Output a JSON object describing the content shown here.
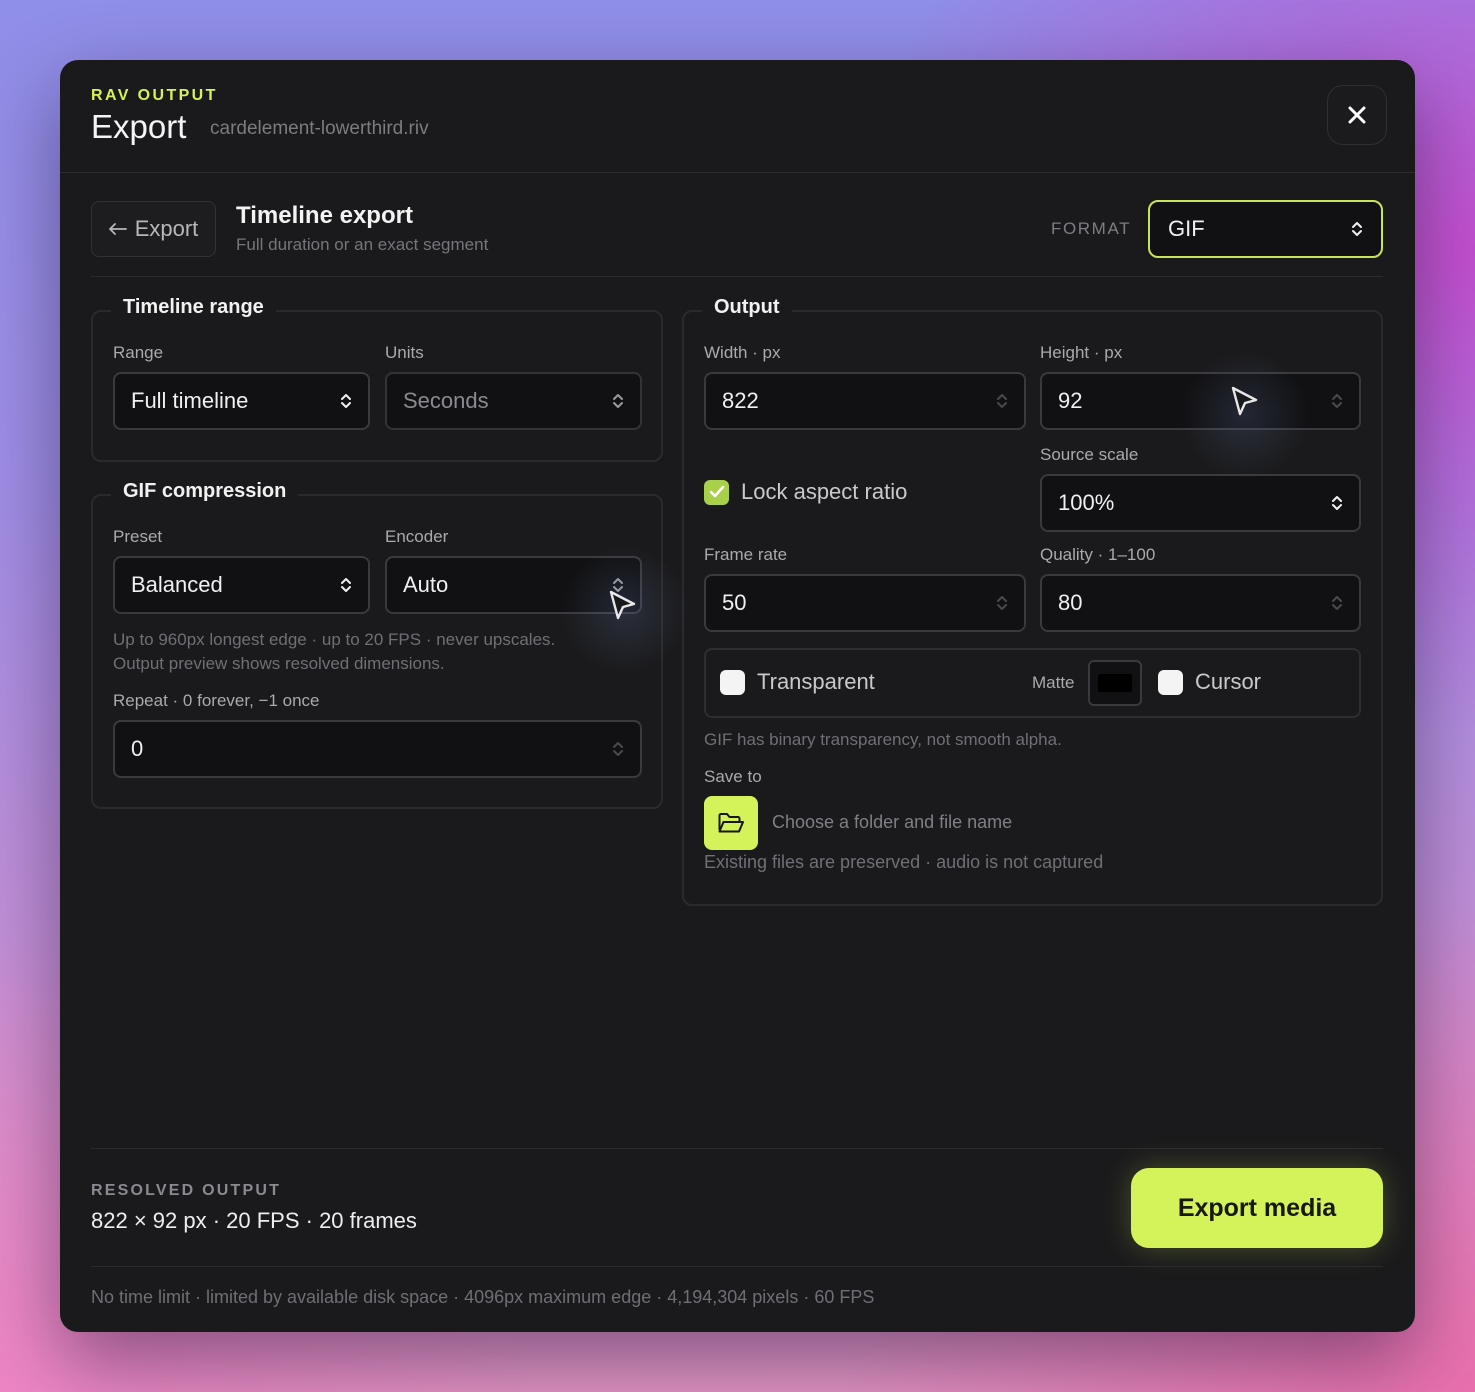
{
  "header": {
    "eyebrow": "RAV OUTPUT",
    "title": "Export",
    "filename": "cardelement-lowerthird.riv",
    "close_icon": "close-icon"
  },
  "subheader": {
    "back_label": "Export",
    "title": "Timeline export",
    "description": "Full duration or an exact segment",
    "format_label": "FORMAT",
    "format_value": "GIF"
  },
  "timeline_range": {
    "legend": "Timeline range",
    "range_label": "Range",
    "range_value": "Full timeline",
    "units_label": "Units",
    "units_value": "Seconds"
  },
  "gif_compression": {
    "legend": "GIF compression",
    "preset_label": "Preset",
    "preset_value": "Balanced",
    "encoder_label": "Encoder",
    "encoder_value": "Auto",
    "hint_line1": "Up to 960px longest edge · up to 20 FPS · never upscales.",
    "hint_line2": "Output preview shows resolved dimensions.",
    "repeat_label": "Repeat · 0 forever, −1 once",
    "repeat_value": "0"
  },
  "output": {
    "legend": "Output",
    "width_label": "Width · px",
    "width_value": "822",
    "height_label": "Height · px",
    "height_value": "92",
    "lock_label": "Lock aspect ratio",
    "lock_checked": true,
    "source_scale_label": "Source scale",
    "source_scale_value": "100%",
    "frame_rate_label": "Frame rate",
    "frame_rate_value": "50",
    "quality_label": "Quality · 1–100",
    "quality_value": "80",
    "transparent_label": "Transparent",
    "transparent_checked": false,
    "matte_label": "Matte",
    "matte_color": "#000000",
    "cursor_label": "Cursor",
    "cursor_checked": false,
    "transparency_hint": "GIF has binary transparency, not smooth alpha.",
    "save_to_label": "Save to",
    "save_to_placeholder": "Choose a folder and file name",
    "save_hint": "Existing files are preserved · audio is not captured"
  },
  "footer": {
    "resolved_label": "RESOLVED OUTPUT",
    "resolved_value": "822 × 92 px · 20 FPS · 20 frames",
    "export_button": "Export media",
    "limits": "No time limit · limited by available disk space · 4096px maximum edge · 4,194,304 pixels · 60 FPS"
  },
  "colors": {
    "accent": "#d4f25a",
    "panel": "#1a1a1c",
    "check": "#a8d04a"
  }
}
